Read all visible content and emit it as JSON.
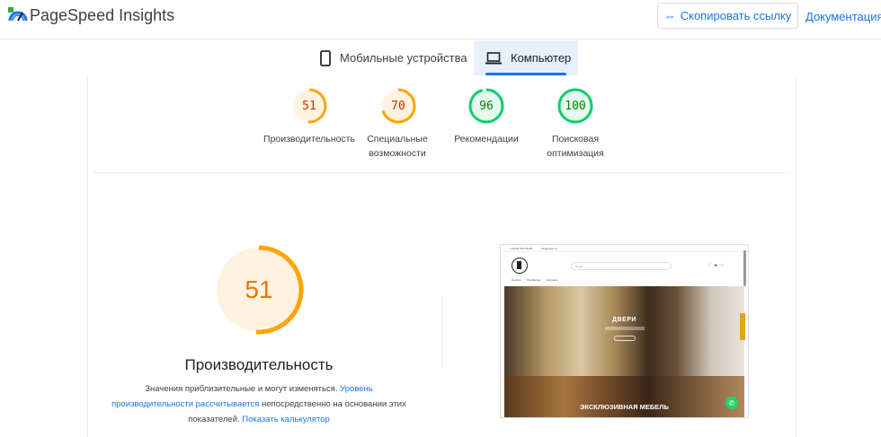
{
  "header": {
    "app_title": "PageSpeed Insights",
    "copy_link_label": "Скопировать ссылку",
    "docs_label": "Документация"
  },
  "tabs": [
    {
      "label": "Мобильные устройства",
      "icon": "smartphone-icon",
      "selected": false
    },
    {
      "label": "Компьютер",
      "icon": "laptop-icon",
      "selected": true
    }
  ],
  "colors": {
    "accent": "#1a73e8",
    "average": "#ffa400",
    "average_fill": "#fff3e0",
    "pass": "#0cce6b",
    "pass_fill": "#e6f9ee",
    "tab_selected_bg": "#e8f0fe"
  },
  "categories": [
    {
      "score": "51",
      "value": 51,
      "label": "Производительность",
      "status": "average"
    },
    {
      "score": "70",
      "value": 70,
      "label": "Специальные возможности",
      "status": "average"
    },
    {
      "score": "96",
      "value": 96,
      "label": "Рекомендации",
      "status": "pass"
    },
    {
      "score": "100",
      "value": 100,
      "label": "Поисковая оптимизация",
      "status": "pass"
    }
  ],
  "performance": {
    "score": "51",
    "value": 51,
    "title": "Производительность",
    "desc_part1": "Значения приблизительные и могут изменяться. ",
    "desc_link1": "Уровень производительности рассчитывается",
    "desc_part2": " непосредственно на основании этих показателей. ",
    "desc_link2": "Показать калькулятор"
  },
  "screenshot": {
    "top_phone": "+7(926) 567-65-88",
    "top_email": "info@dveri.ru",
    "search_placeholder": "Поиск",
    "nav_items": [
      "Каталог",
      "Портфолио",
      "Контакты"
    ],
    "hero_title": "ДВЕРИ",
    "bottom_title": "ЭКСКЛЮЗИВНАЯ МЕБЕЛЬ"
  }
}
